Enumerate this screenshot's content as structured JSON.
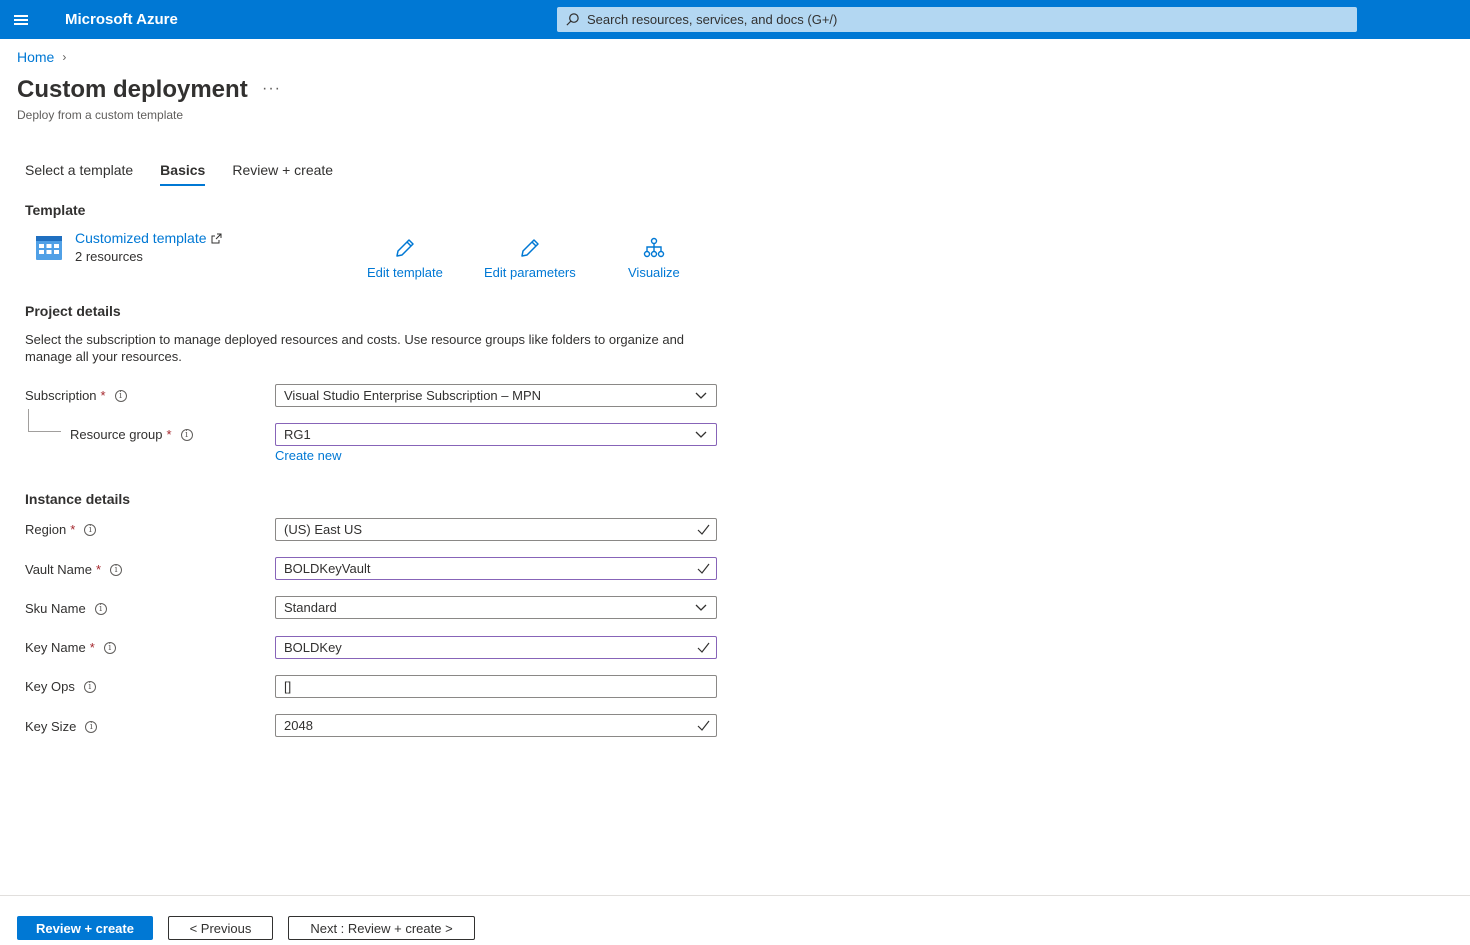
{
  "topbar": {
    "brand": "Microsoft Azure",
    "search_placeholder": "Search resources, services, and docs (G+/)"
  },
  "breadcrumb": {
    "home": "Home"
  },
  "page": {
    "title": "Custom deployment",
    "more": "···",
    "subtitle": "Deploy from a custom template"
  },
  "tabs": [
    {
      "label": "Select a template",
      "active": false
    },
    {
      "label": "Basics",
      "active": true
    },
    {
      "label": "Review + create",
      "active": false
    }
  ],
  "template": {
    "heading": "Template",
    "link_label": "Customized template",
    "resources": "2 resources",
    "actions": {
      "edit_template": "Edit template",
      "edit_parameters": "Edit parameters",
      "visualize": "Visualize"
    }
  },
  "project": {
    "heading": "Project details",
    "description": "Select the subscription to manage deployed resources and costs. Use resource groups like folders to organize and manage all your resources.",
    "subscription": {
      "label": "Subscription",
      "required": "*",
      "value": "Visual Studio Enterprise Subscription – MPN"
    },
    "resource_group": {
      "label": "Resource group",
      "required": "*",
      "value": "RG1",
      "create_new": "Create new"
    }
  },
  "instance": {
    "heading": "Instance details",
    "region": {
      "label": "Region",
      "required": "*",
      "value": "(US) East US"
    },
    "vault_name": {
      "label": "Vault Name",
      "required": "*",
      "value": "BOLDKeyVault"
    },
    "sku_name": {
      "label": "Sku Name",
      "value": "Standard"
    },
    "key_name": {
      "label": "Key Name",
      "required": "*",
      "value": "BOLDKey"
    },
    "key_ops": {
      "label": "Key Ops",
      "value": "[]"
    },
    "key_size": {
      "label": "Key Size",
      "value": "2048"
    }
  },
  "footer": {
    "review_create": "Review + create",
    "previous": "< Previous",
    "next": "Next : Review + create >"
  },
  "colors": {
    "accent": "#0078d4",
    "focus_border": "#8764b8",
    "required": "#a4262c"
  },
  "icons": {
    "menu": "hamburger-icon",
    "search": "search-icon",
    "template": "template-grid-icon",
    "external": "external-link-icon",
    "edit": "pencil-icon",
    "visualize": "hierarchy-icon",
    "dropdown": "chevron-down-icon",
    "valid": "checkmark-icon",
    "info": "info-icon"
  }
}
